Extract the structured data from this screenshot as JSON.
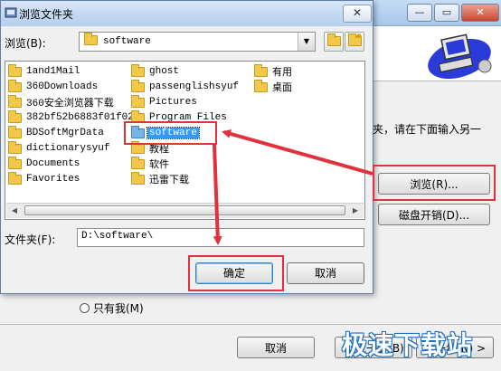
{
  "background_window": {
    "minimize": "—",
    "maximize": "▭",
    "close": "✕",
    "prompt_text": "夹，请在下面输入另一",
    "browse_button": "浏览(R)...",
    "disk_space_button": "磁盘开销(D)...",
    "radio_only_me": "只有我(M)",
    "cancel_button": "取消",
    "back_button": "< 上一步(B)",
    "next_button": "下一步(N) >"
  },
  "dialog": {
    "title": "浏览文件夹",
    "close": "✕",
    "browse_label": "浏览(B):",
    "path_value": "software",
    "folder_label": "文件夹(F):",
    "folder_value": "D:\\software\\",
    "ok_button": "确定",
    "cancel_button": "取消",
    "list_items": [
      "1and1Mail",
      "360Downloads",
      "360安全浏览器下载",
      "382bf52b6883f01f02",
      "BDSoftMgrData",
      "dictionarysyuf",
      "Documents",
      "Favorites",
      "ghost",
      "passenglishsyuf",
      "Pictures",
      "Program Files",
      "software",
      "教程",
      "软件",
      "迅雷下载",
      "有用",
      "桌面"
    ],
    "selected_item": "software"
  },
  "watermark": "极速下载站",
  "colors": {
    "highlight": "#e0323c",
    "selection": "#3399ff"
  }
}
